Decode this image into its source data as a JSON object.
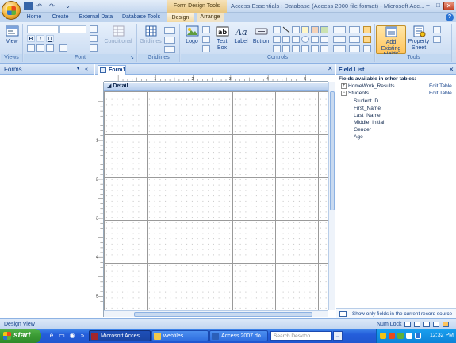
{
  "title_bar": {
    "context_tools": "Form Design Tools",
    "window_title": "Access Essentials : Database (Access 2000 file format) - Microsoft Acc...",
    "min": "–",
    "max": "□",
    "close": "✕"
  },
  "quick_access": {
    "undo": "↶",
    "redo": "↷",
    "more": "⌄"
  },
  "ribbon_tabs": [
    "Home",
    "Create",
    "External Data",
    "Database Tools",
    "Design",
    "Arrange"
  ],
  "ribbon": {
    "groups": {
      "views": "Views",
      "font": "Font",
      "gridlines": "Gridlines",
      "controls": "Controls",
      "tools": "Tools"
    },
    "buttons": {
      "view": "View",
      "conditional": "Conditional",
      "gridlines": "Gridlines",
      "logo": "Logo",
      "text_box": "Text Box",
      "label": "Label",
      "button": "Button",
      "add_existing_fields": "Add Existing Fields",
      "property_sheet": "Property Sheet"
    },
    "font_buttons": [
      "B",
      "I",
      "U"
    ]
  },
  "nav_pane": {
    "title": "Forms",
    "dropdown": "▾",
    "shutter": "«"
  },
  "form": {
    "tab_label": "Form1",
    "close": "✕",
    "section": "Detail",
    "ruler_marks": [
      "1",
      "2",
      "3",
      "4",
      "5"
    ],
    "vruler_marks": [
      "1",
      "2",
      "3",
      "4",
      "5"
    ]
  },
  "field_list": {
    "title": "Field List",
    "subtitle": "Fields available in other tables:",
    "tables": [
      {
        "name": "HomeWork_Results",
        "expanded": false,
        "edit": "Edit Table",
        "fields": []
      },
      {
        "name": "Students",
        "expanded": true,
        "edit": "Edit Table",
        "fields": [
          "Student ID",
          "First_Name",
          "Last_Name",
          "Middle_Initial",
          "Gender",
          "Age"
        ]
      }
    ],
    "footer": "Show only fields in the current record source"
  },
  "status_bar": {
    "text": "Design View",
    "numlock": "Num Lock"
  },
  "taskbar": {
    "start": "start",
    "tasks": [
      {
        "label": "Microsoft Acces...",
        "active": true,
        "color": "#a1262c"
      },
      {
        "label": "webfiles",
        "active": false,
        "color": "#f2c94c"
      },
      {
        "label": "Access 2007.do...",
        "active": false,
        "color": "#2b5fb8"
      }
    ],
    "search_placeholder": "Search Desktop",
    "clock": "12:32 PM"
  },
  "colors": {
    "accent": "#15428b",
    "ribbon": "#d3e2f5",
    "taskbar": "#245edb",
    "start": "#3a9a34",
    "highlight": "#ffc45c"
  }
}
